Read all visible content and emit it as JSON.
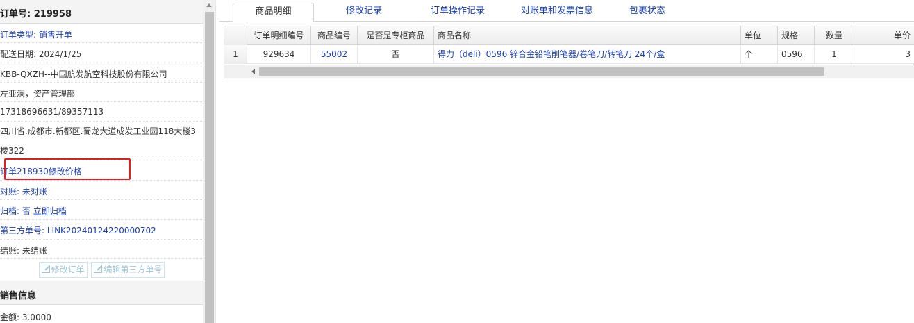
{
  "left": {
    "order_no_label": "订单号:",
    "order_no": "219958",
    "order_type": "订单类型: 销售开单",
    "delivery_date": "配送日期: 2024/1/25",
    "company": "KBB-QXZH--中国航发航空科技股份有限公司",
    "contact": "左亚澜，资产管理部",
    "phone": "17318696631/89357113",
    "address": "四川省.成都市.新都区.蜀龙大道成发工业园118大楼3楼322",
    "order_note": "订单218930修改价格",
    "reconcile": "对账: 未对账",
    "archive_label": "归档:",
    "archive_value": "否",
    "archive_link": "立即归档",
    "third_party": "第三方单号: LINK20240124220000702",
    "settle": "结账: 未结账",
    "edit_order_btn": "修改订单",
    "edit_third_btn": "编辑第三方单号",
    "sales_info_title": "销售信息",
    "amount": "金额: 3.0000"
  },
  "tabs": [
    {
      "label": "商品明细",
      "active": true
    },
    {
      "label": "修改记录"
    },
    {
      "label": "订单操作记录"
    },
    {
      "label": "对账单和发票信息"
    },
    {
      "label": "包裹状态"
    }
  ],
  "table": {
    "headers": [
      "订单明细编号",
      "商品编号",
      "是否是专柜商品",
      "商品名称",
      "单位",
      "规格",
      "数量",
      "单价"
    ],
    "rows": [
      {
        "rownum": "1",
        "detail_no": "929634",
        "product_no": "55002",
        "counter": "否",
        "name": "得力（deli）0596 锌合金铅笔削笔器/卷笔刀/转笔刀 24个/盒",
        "unit": "个",
        "spec": "0596",
        "qty": "1",
        "price": "3"
      }
    ]
  },
  "colors": {
    "link": "#1a3fb5",
    "highlight": "#e02020"
  }
}
